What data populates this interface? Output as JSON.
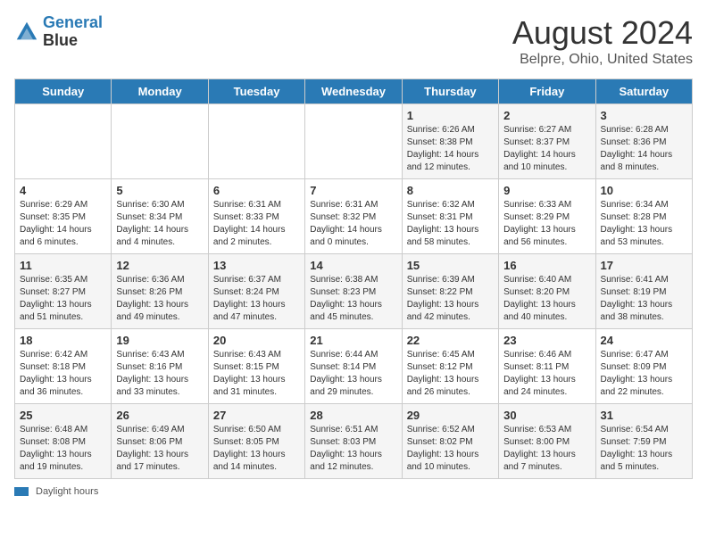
{
  "header": {
    "logo_line1": "General",
    "logo_line2": "Blue",
    "main_title": "August 2024",
    "subtitle": "Belpre, Ohio, United States"
  },
  "days_of_week": [
    "Sunday",
    "Monday",
    "Tuesday",
    "Wednesday",
    "Thursday",
    "Friday",
    "Saturday"
  ],
  "weeks": [
    [
      {
        "day": "",
        "info": ""
      },
      {
        "day": "",
        "info": ""
      },
      {
        "day": "",
        "info": ""
      },
      {
        "day": "",
        "info": ""
      },
      {
        "day": "1",
        "info": "Sunrise: 6:26 AM\nSunset: 8:38 PM\nDaylight: 14 hours and 12 minutes."
      },
      {
        "day": "2",
        "info": "Sunrise: 6:27 AM\nSunset: 8:37 PM\nDaylight: 14 hours and 10 minutes."
      },
      {
        "day": "3",
        "info": "Sunrise: 6:28 AM\nSunset: 8:36 PM\nDaylight: 14 hours and 8 minutes."
      }
    ],
    [
      {
        "day": "4",
        "info": "Sunrise: 6:29 AM\nSunset: 8:35 PM\nDaylight: 14 hours and 6 minutes."
      },
      {
        "day": "5",
        "info": "Sunrise: 6:30 AM\nSunset: 8:34 PM\nDaylight: 14 hours and 4 minutes."
      },
      {
        "day": "6",
        "info": "Sunrise: 6:31 AM\nSunset: 8:33 PM\nDaylight: 14 hours and 2 minutes."
      },
      {
        "day": "7",
        "info": "Sunrise: 6:31 AM\nSunset: 8:32 PM\nDaylight: 14 hours and 0 minutes."
      },
      {
        "day": "8",
        "info": "Sunrise: 6:32 AM\nSunset: 8:31 PM\nDaylight: 13 hours and 58 minutes."
      },
      {
        "day": "9",
        "info": "Sunrise: 6:33 AM\nSunset: 8:29 PM\nDaylight: 13 hours and 56 minutes."
      },
      {
        "day": "10",
        "info": "Sunrise: 6:34 AM\nSunset: 8:28 PM\nDaylight: 13 hours and 53 minutes."
      }
    ],
    [
      {
        "day": "11",
        "info": "Sunrise: 6:35 AM\nSunset: 8:27 PM\nDaylight: 13 hours and 51 minutes."
      },
      {
        "day": "12",
        "info": "Sunrise: 6:36 AM\nSunset: 8:26 PM\nDaylight: 13 hours and 49 minutes."
      },
      {
        "day": "13",
        "info": "Sunrise: 6:37 AM\nSunset: 8:24 PM\nDaylight: 13 hours and 47 minutes."
      },
      {
        "day": "14",
        "info": "Sunrise: 6:38 AM\nSunset: 8:23 PM\nDaylight: 13 hours and 45 minutes."
      },
      {
        "day": "15",
        "info": "Sunrise: 6:39 AM\nSunset: 8:22 PM\nDaylight: 13 hours and 42 minutes."
      },
      {
        "day": "16",
        "info": "Sunrise: 6:40 AM\nSunset: 8:20 PM\nDaylight: 13 hours and 40 minutes."
      },
      {
        "day": "17",
        "info": "Sunrise: 6:41 AM\nSunset: 8:19 PM\nDaylight: 13 hours and 38 minutes."
      }
    ],
    [
      {
        "day": "18",
        "info": "Sunrise: 6:42 AM\nSunset: 8:18 PM\nDaylight: 13 hours and 36 minutes."
      },
      {
        "day": "19",
        "info": "Sunrise: 6:43 AM\nSunset: 8:16 PM\nDaylight: 13 hours and 33 minutes."
      },
      {
        "day": "20",
        "info": "Sunrise: 6:43 AM\nSunset: 8:15 PM\nDaylight: 13 hours and 31 minutes."
      },
      {
        "day": "21",
        "info": "Sunrise: 6:44 AM\nSunset: 8:14 PM\nDaylight: 13 hours and 29 minutes."
      },
      {
        "day": "22",
        "info": "Sunrise: 6:45 AM\nSunset: 8:12 PM\nDaylight: 13 hours and 26 minutes."
      },
      {
        "day": "23",
        "info": "Sunrise: 6:46 AM\nSunset: 8:11 PM\nDaylight: 13 hours and 24 minutes."
      },
      {
        "day": "24",
        "info": "Sunrise: 6:47 AM\nSunset: 8:09 PM\nDaylight: 13 hours and 22 minutes."
      }
    ],
    [
      {
        "day": "25",
        "info": "Sunrise: 6:48 AM\nSunset: 8:08 PM\nDaylight: 13 hours and 19 minutes."
      },
      {
        "day": "26",
        "info": "Sunrise: 6:49 AM\nSunset: 8:06 PM\nDaylight: 13 hours and 17 minutes."
      },
      {
        "day": "27",
        "info": "Sunrise: 6:50 AM\nSunset: 8:05 PM\nDaylight: 13 hours and 14 minutes."
      },
      {
        "day": "28",
        "info": "Sunrise: 6:51 AM\nSunset: 8:03 PM\nDaylight: 13 hours and 12 minutes."
      },
      {
        "day": "29",
        "info": "Sunrise: 6:52 AM\nSunset: 8:02 PM\nDaylight: 13 hours and 10 minutes."
      },
      {
        "day": "30",
        "info": "Sunrise: 6:53 AM\nSunset: 8:00 PM\nDaylight: 13 hours and 7 minutes."
      },
      {
        "day": "31",
        "info": "Sunrise: 6:54 AM\nSunset: 7:59 PM\nDaylight: 13 hours and 5 minutes."
      }
    ]
  ],
  "footer": {
    "legend_label": "Daylight hours"
  }
}
